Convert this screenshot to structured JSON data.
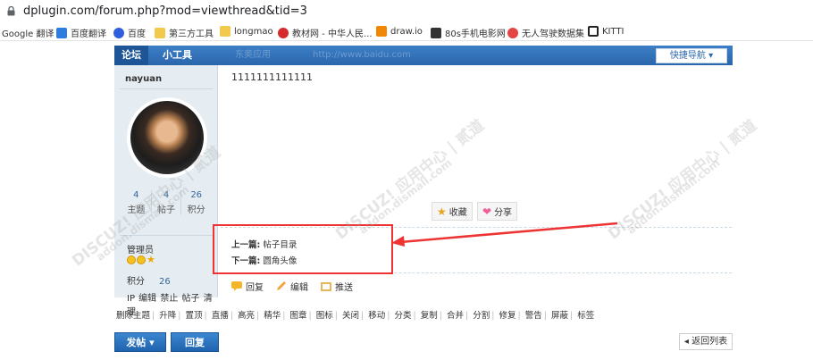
{
  "browser": {
    "url": "dplugin.com/forum.php?mod=viewthread&tid=3",
    "bookmarks": [
      {
        "label": "Google 翻译",
        "icon": "none"
      },
      {
        "label": "百度翻译",
        "icon": "baidu-translate-icon"
      },
      {
        "label": "百度",
        "icon": "baidu-paw-icon"
      },
      {
        "label": "第三方工具",
        "icon": "folder-icon"
      },
      {
        "label": "longmao",
        "icon": "folder-icon"
      },
      {
        "label": "教材网 - 中华人民...",
        "icon": "textbook-icon"
      },
      {
        "label": "draw.io",
        "icon": "drawio-icon"
      },
      {
        "label": "80s手机电影网",
        "icon": "film-icon"
      },
      {
        "label": "无人驾驶数据集",
        "icon": "data-icon"
      },
      {
        "label": "KITTI",
        "icon": "kitti-icon"
      }
    ]
  },
  "forum": {
    "tabs": [
      "论坛",
      "小工具"
    ],
    "faint_links": [
      "东奥应用",
      "http://www.baidu.com"
    ],
    "quick_nav": "快捷导航 ▾",
    "user": {
      "name": "nayuan",
      "stats": [
        {
          "value": "4",
          "label": "主题"
        },
        {
          "value": "4",
          "label": "帖子"
        },
        {
          "value": "26",
          "label": "积分"
        }
      ],
      "role": "管理员",
      "score_label": "积分",
      "score_value": "26",
      "actions": "IP 编辑 禁止 帖子 清理"
    },
    "post": {
      "message": "1111111111111",
      "favorite_label": "收藏",
      "share_label": "分享",
      "prev_label": "上一篇:",
      "prev_title": "帖子目录",
      "next_label": "下一篇:",
      "next_title": "圆角头像",
      "reply_actions": [
        "回复",
        "编辑",
        "推送"
      ]
    },
    "mod_actions": [
      "删除主题",
      "升降",
      "置顶",
      "直播",
      "高亮",
      "精华",
      "图章",
      "图标",
      "关闭",
      "移动",
      "分类",
      "复制",
      "合并",
      "分割",
      "修复",
      "警告",
      "屏蔽",
      "标签"
    ],
    "post_button": "发帖 ▾",
    "reply_button": "回复",
    "back_button": "◂ 返回列表"
  },
  "watermark": {
    "brand": "DISCUZ! 应用中心 | 贰道",
    "domain": "addon.dismall.com"
  },
  "colors": {
    "header_blue": "#2f6eb5",
    "sidebar": "#e5edf2",
    "highlight_box": "#e33333"
  }
}
